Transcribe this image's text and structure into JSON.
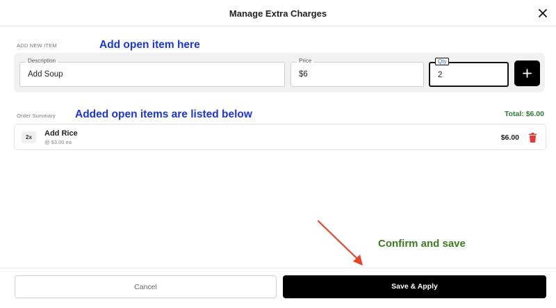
{
  "header": {
    "title": "Manage Extra Charges"
  },
  "add_section": {
    "label": "ADD NEW ITEM",
    "annotation": "Add open item here",
    "description": {
      "label": "Description",
      "value": "Add Soup"
    },
    "price": {
      "label": "Price",
      "value": "$6"
    },
    "qty": {
      "label": "Qty",
      "value": "2"
    }
  },
  "order_summary": {
    "label": "Order Summary",
    "annotation": "Added open items are listed below",
    "total": "Total: $6.00",
    "items": [
      {
        "qty": "2x",
        "name": "Add Rice",
        "unit": "@ $3.00 ea",
        "price": "$6.00"
      }
    ]
  },
  "annotations": {
    "confirm": "Confirm and save"
  },
  "footer": {
    "cancel_label": "Cancel",
    "save_label": "Save & Apply"
  },
  "colors": {
    "annotation_blue": "#1a35e0",
    "annotation_green": "#3a7d1e",
    "total_green": "#2e7d32",
    "delete_red": "#e53935",
    "arrow_red": "#e8442a"
  },
  "icons": {
    "close": "close-icon",
    "add": "plus-icon",
    "delete": "trash-icon",
    "arrow": "arrow-icon"
  }
}
